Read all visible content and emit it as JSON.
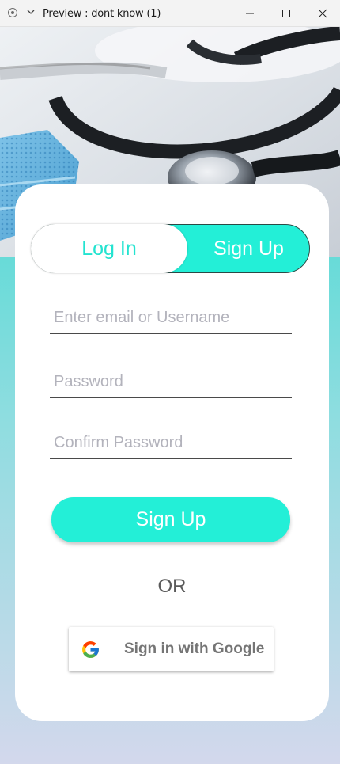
{
  "window": {
    "title": "Preview : dont know (1)",
    "icons": [
      "app-icon",
      "chevron-down-icon",
      "minimize-icon",
      "maximize-icon",
      "close-icon"
    ]
  },
  "auth": {
    "tabs": [
      {
        "label": "Log In",
        "selected": false
      },
      {
        "label": "Sign Up",
        "selected": true
      }
    ],
    "email_placeholder": "Enter email or Username",
    "password_placeholder": "Password",
    "confirm_placeholder": "Confirm Password",
    "submit_label": "Sign Up",
    "divider_text": "OR",
    "google_label": "Sign in with Google"
  },
  "colors": {
    "accent": "#23efd7",
    "card": "#ffffff",
    "placeholder": "#b3b3bc",
    "divider_text": "#5a5a5a"
  }
}
